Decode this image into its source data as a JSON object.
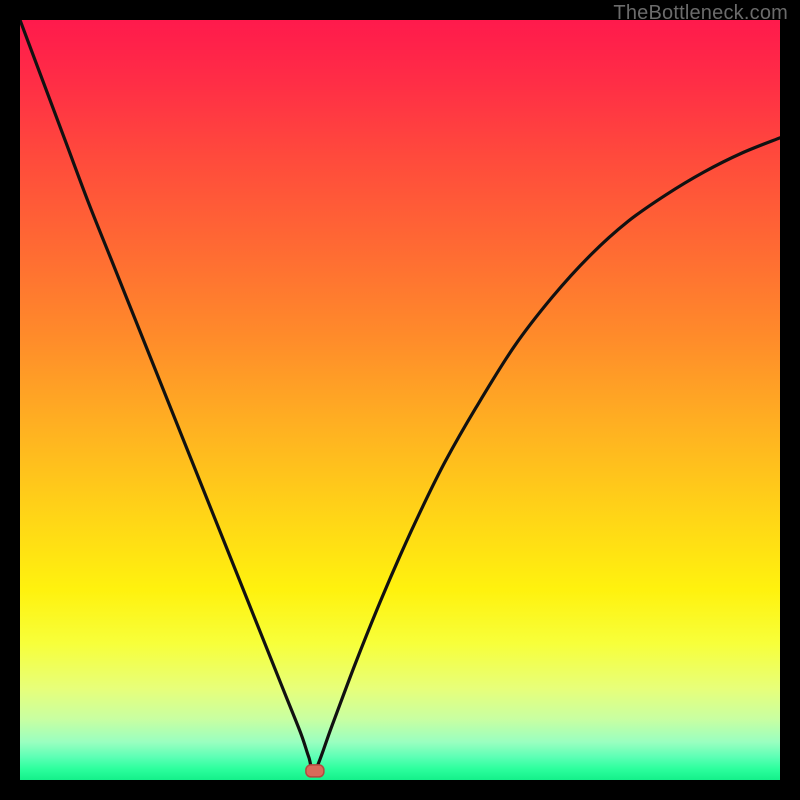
{
  "watermark": "TheBottleneck.com",
  "colors": {
    "background": "#000000",
    "curve": "#111111",
    "marker_fill": "#d96a5a",
    "marker_stroke": "#b34a3f"
  },
  "chart_data": {
    "type": "line",
    "title": "",
    "xlabel": "",
    "ylabel": "",
    "xlim": [
      0,
      100
    ],
    "ylim": [
      0,
      100
    ],
    "grid": false,
    "legend": false,
    "series": [
      {
        "name": "bottleneck-curve",
        "x": [
          0,
          3,
          6,
          9,
          12,
          15,
          18,
          21,
          24,
          27,
          30,
          33,
          35,
          37,
          38,
          38.8,
          41,
          44,
          47,
          50,
          53,
          56,
          60,
          65,
          70,
          75,
          80,
          85,
          90,
          95,
          100
        ],
        "values": [
          100,
          92,
          84,
          76,
          68.5,
          61,
          53.5,
          46,
          38.5,
          31,
          23.5,
          16,
          11,
          6,
          3,
          1.2,
          7,
          15,
          22.5,
          29.5,
          36,
          42,
          49,
          57,
          63.5,
          69,
          73.5,
          77,
          80,
          82.5,
          84.5
        ]
      }
    ],
    "marker": {
      "name": "optimal-point",
      "x": 38.8,
      "y": 1.2,
      "shape": "rounded-rect"
    }
  }
}
